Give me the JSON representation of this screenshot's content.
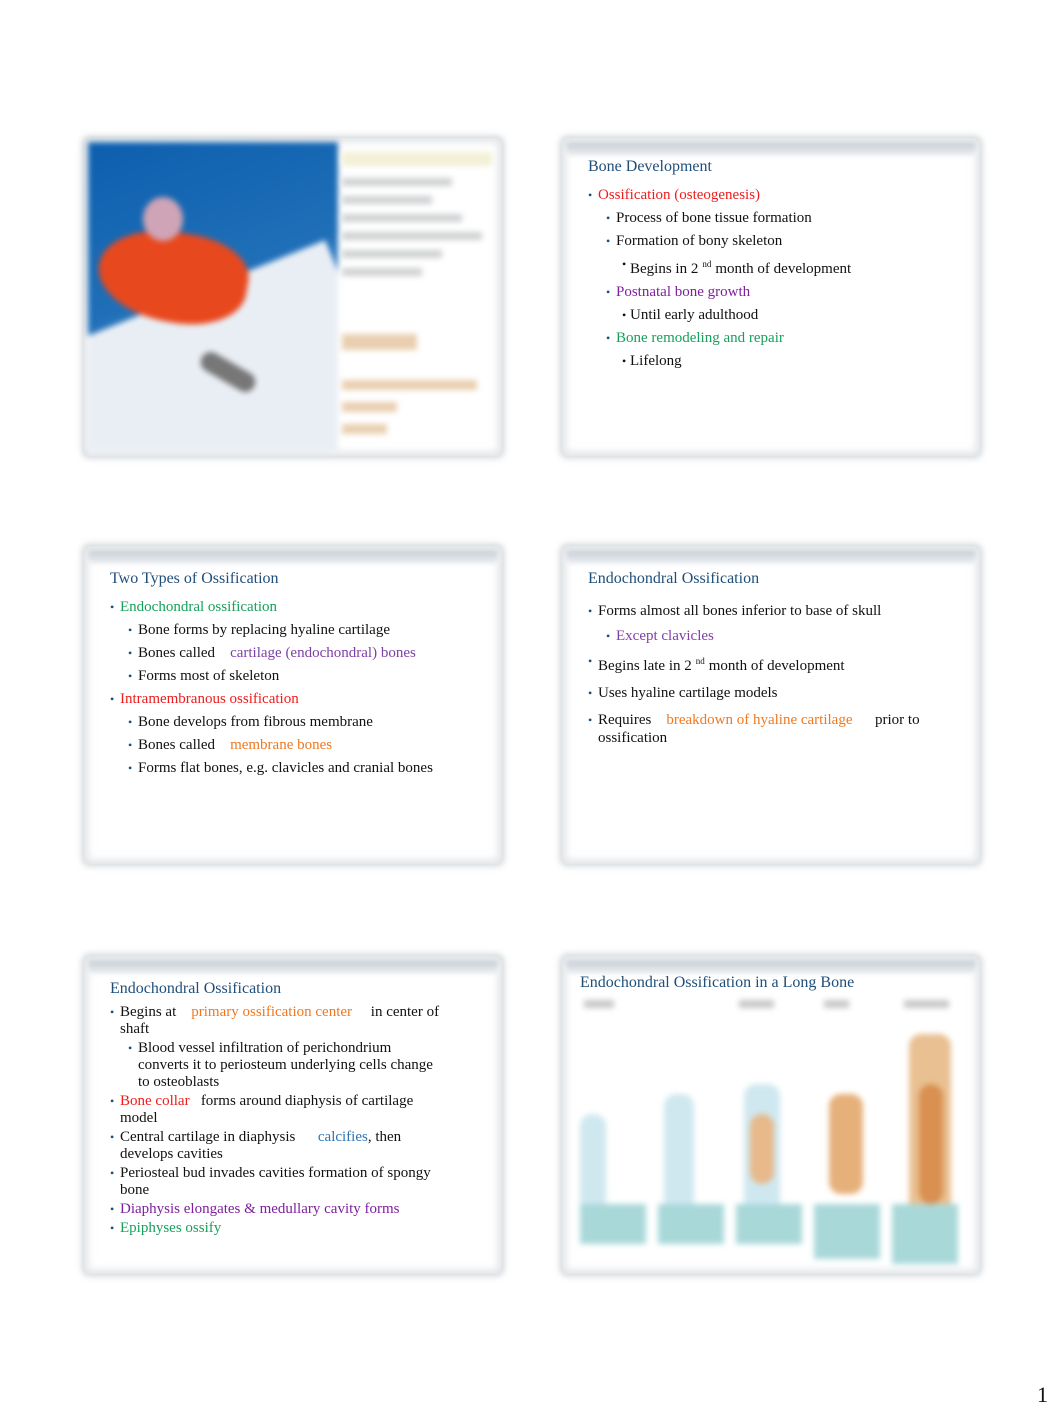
{
  "page_number": "1",
  "slides": [
    {
      "id": 1,
      "type": "image",
      "image_description": "Blurred cover image of a skier in a red jacket on a snowy slope with blurred text panel"
    },
    {
      "id": 2,
      "title": "Bone Development",
      "items": [
        {
          "level": 1,
          "text": "Ossification (osteogenesis)",
          "color": "red"
        },
        {
          "level": 2,
          "text": "Process of bone tissue formation"
        },
        {
          "level": 2,
          "text": "Formation of bony skeleton"
        },
        {
          "level": 3,
          "pre": "Begins in 2",
          "sup": "nd",
          "post": "month of development"
        },
        {
          "level": 2,
          "text": "Postnatal bone growth",
          "color": "purple"
        },
        {
          "level": 3,
          "text": "Until early adulthood"
        },
        {
          "level": 2,
          "text": "Bone remodeling and repair",
          "color": "green"
        },
        {
          "level": 3,
          "text": "Lifelong"
        }
      ]
    },
    {
      "id": 3,
      "title": "Two Types of Ossification",
      "items": [
        {
          "level": 1,
          "text": "Endochondral ossification",
          "color": "green"
        },
        {
          "level": 2,
          "text": "Bone forms by replacing hyaline cartilage"
        },
        {
          "level": 2,
          "pre": "Bones called",
          "highlight": "cartilage (endochondral) bones",
          "color": "violet"
        },
        {
          "level": 2,
          "text": "Forms most of skeleton"
        },
        {
          "level": 1,
          "text": "Intramembranous ossification",
          "color": "red"
        },
        {
          "level": 2,
          "text": "Bone develops from fibrous membrane"
        },
        {
          "level": 2,
          "pre": "Bones called",
          "highlight": "membrane bones",
          "color": "orange"
        },
        {
          "level": 2,
          "text": "Forms flat bones, e.g. clavicles and cranial bones"
        }
      ]
    },
    {
      "id": 4,
      "title": "Endochondral Ossification",
      "items": [
        {
          "level": 1,
          "text": "Forms almost all bones inferior to base of skull"
        },
        {
          "level": 2,
          "text": "Except clavicles",
          "color": "violet"
        },
        {
          "level": 1,
          "pre": "Begins late in 2",
          "sup": "nd",
          "post": "month of development"
        },
        {
          "level": 1,
          "text": "Uses hyaline cartilage models"
        },
        {
          "level": 1,
          "pre": "Requires",
          "highlight": "breakdown of hyaline cartilage",
          "color": "orange",
          "post": "prior to ossification"
        }
      ]
    },
    {
      "id": 5,
      "title": "Endochondral Ossification",
      "items": [
        {
          "level": 1,
          "pre": "Begins at",
          "highlight": "primary ossification center",
          "color": "orange",
          "post": "in center of shaft"
        },
        {
          "level": 2,
          "text": "Blood vessel infiltration of perichondrium converts it to periosteum  underlying cells change to osteoblasts"
        },
        {
          "level": 1,
          "highlight": "Bone collar",
          "color": "red",
          "post": "forms around diaphysis of cartilage model"
        },
        {
          "level": 1,
          "pre": "Central cartilage in diaphysis",
          "highlight": "calcifies",
          "color": "blue",
          "post": ", then develops cavities"
        },
        {
          "level": 1,
          "text": "Periosteal bud invades cavities  formation of spongy bone"
        },
        {
          "level": 1,
          "text": "Diaphysis elongates & medullary cavity forms",
          "color": "purple"
        },
        {
          "level": 1,
          "text": "Epiphyses ossify",
          "color": "green"
        }
      ]
    },
    {
      "id": 6,
      "title": "Endochondral Ossification in a Long Bone",
      "type": "diagram",
      "image_description": "Blurred figure showing stages of endochondral ossification in a long bone"
    }
  ],
  "s2": {
    "title": "Bone Development",
    "b1": "Ossification (osteogenesis)",
    "b2": "Process of bone tissue formation",
    "b3": "Formation of bony skeleton",
    "b4_pre": "Begins in 2",
    "b4_sup": "nd",
    "b4_post": "month of development",
    "b5": "Postnatal bone growth",
    "b6": "Until early adulthood",
    "b7": "Bone remodeling and repair",
    "b8": "Lifelong"
  },
  "s3": {
    "title": "Two Types of Ossification",
    "b1": "Endochondral ossification",
    "b2": "Bone forms by replacing hyaline cartilage",
    "b3_pre": "Bones called",
    "b3_hl": "cartilage (endochondral) bones",
    "b4": "Forms most of skeleton",
    "b5": "Intramembranous ossification",
    "b6": "Bone develops from fibrous membrane",
    "b7_pre": "Bones called",
    "b7_hl": "membrane bones",
    "b8": "Forms flat bones, e.g. clavicles and cranial bones"
  },
  "s4": {
    "title": "Endochondral Ossification",
    "b1": "Forms almost all bones inferior to base of skull",
    "b2": "Except clavicles",
    "b3_pre": "Begins late in 2",
    "b3_sup": "nd",
    "b3_post": "month of development",
    "b4": "Uses hyaline cartilage models",
    "b5_pre": "Requires",
    "b5_hl": "breakdown of hyaline cartilage",
    "b5_post": "prior to ossification"
  },
  "s5": {
    "title": "Endochondral Ossification",
    "b1_pre": "Begins at",
    "b1_hl": "primary ossification center",
    "b1_post": "in center of shaft",
    "b2": "Blood vessel infiltration of perichondrium converts it to periosteum  underlying cells change to osteoblasts",
    "b3_hl": "Bone collar",
    "b3_post": "forms around diaphysis of cartilage model",
    "b4_pre": "Central cartilage in diaphysis",
    "b4_hl": "calcifies",
    "b4_post": ", then develops cavities",
    "b5": "Periosteal bud invades cavities  formation of spongy bone",
    "b6": "Diaphysis elongates & medullary cavity forms",
    "b7": "Epiphyses ossify"
  },
  "s6": {
    "title": "Endochondral Ossification in a Long Bone"
  },
  "colors": {
    "title": "#1f4e79",
    "red": "#ee1c1c",
    "purple": "#7f1f9f",
    "violet": "#7e3fa6",
    "green": "#17a05b",
    "orange": "#f07820",
    "blue": "#2e74b5"
  }
}
